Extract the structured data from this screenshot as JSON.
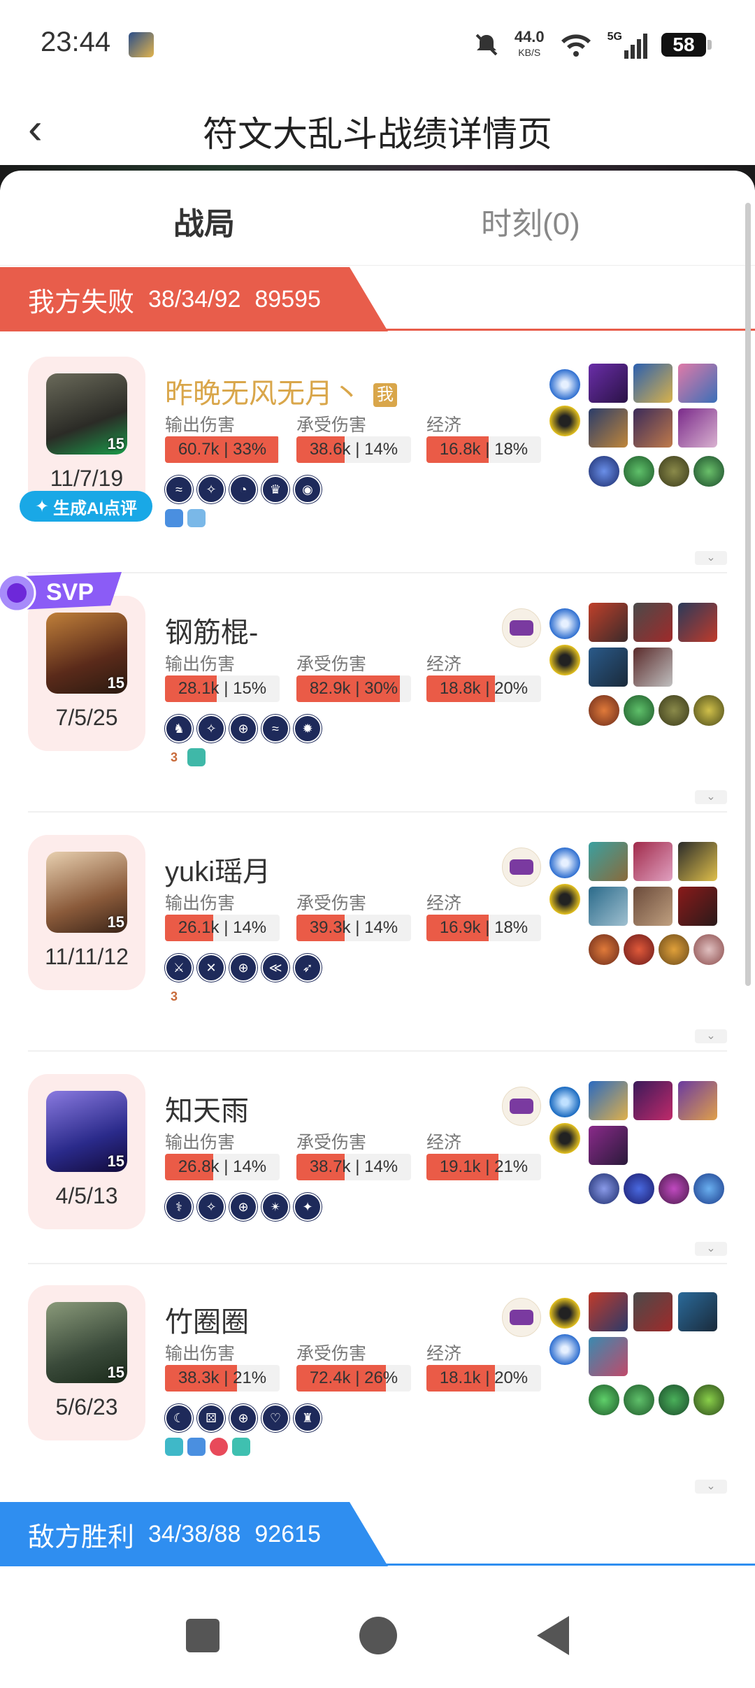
{
  "status_bar": {
    "time": "23:44",
    "speed": "44.0",
    "speed_unit": "KB/S",
    "network": "5G",
    "battery": "58"
  },
  "header": {
    "title": "符文大乱斗战绩详情页",
    "back_glyph": "‹"
  },
  "tabs": [
    {
      "label": "战局"
    },
    {
      "label": "时刻(0)"
    }
  ],
  "our_team": {
    "label": "我方失败",
    "kda": "38/34/92",
    "gold": "89595"
  },
  "enemy_team": {
    "label": "敌方胜利",
    "kda": "34/38/88",
    "gold": "92615"
  },
  "labels": {
    "damage_dealt": "输出伤害",
    "damage_taken": "承受伤害",
    "economy": "经济",
    "me": "我",
    "ai_review": "生成AI点评",
    "svp": "SVP"
  },
  "players": [
    {
      "name": "昨晚无风无月丶",
      "kda": "11/7/19",
      "level": "15",
      "dealt": "60.7k | 33%",
      "dealt_pct": 33,
      "taken": "38.6k | 14%",
      "taken_pct": 14,
      "gold": "16.8k | 18%",
      "gold_pct": 18,
      "tags_text": ""
    },
    {
      "name": "钢筋棍-",
      "kda": "7/5/25",
      "level": "15",
      "dealt": "28.1k | 15%",
      "dealt_pct": 15,
      "taken": "82.9k | 30%",
      "taken_pct": 30,
      "gold": "18.8k | 20%",
      "gold_pct": 20,
      "tags_text": "3"
    },
    {
      "name": "yuki瑶月",
      "kda": "11/11/12",
      "level": "15",
      "dealt": "26.1k | 14%",
      "dealt_pct": 14,
      "taken": "39.3k | 14%",
      "taken_pct": 14,
      "gold": "16.9k | 18%",
      "gold_pct": 18,
      "tags_text": "3"
    },
    {
      "name": "知天雨",
      "kda": "4/5/13",
      "level": "15",
      "dealt": "26.8k | 14%",
      "dealt_pct": 14,
      "taken": "38.7k | 14%",
      "taken_pct": 14,
      "gold": "19.1k | 21%",
      "gold_pct": 21,
      "tags_text": ""
    },
    {
      "name": "竹圈圈",
      "kda": "5/6/23",
      "level": "15",
      "dealt": "38.3k | 21%",
      "dealt_pct": 21,
      "taken": "72.4k | 26%",
      "taken_pct": 26,
      "gold": "18.1k | 20%",
      "gold_pct": 20,
      "tags_text": ""
    }
  ],
  "colors": {
    "lose": "#e85d4b",
    "win": "#2f8ef0",
    "bar_fill": "#ea5b47",
    "self_name": "#d9a64a",
    "ai_button": "#19a8e6"
  }
}
